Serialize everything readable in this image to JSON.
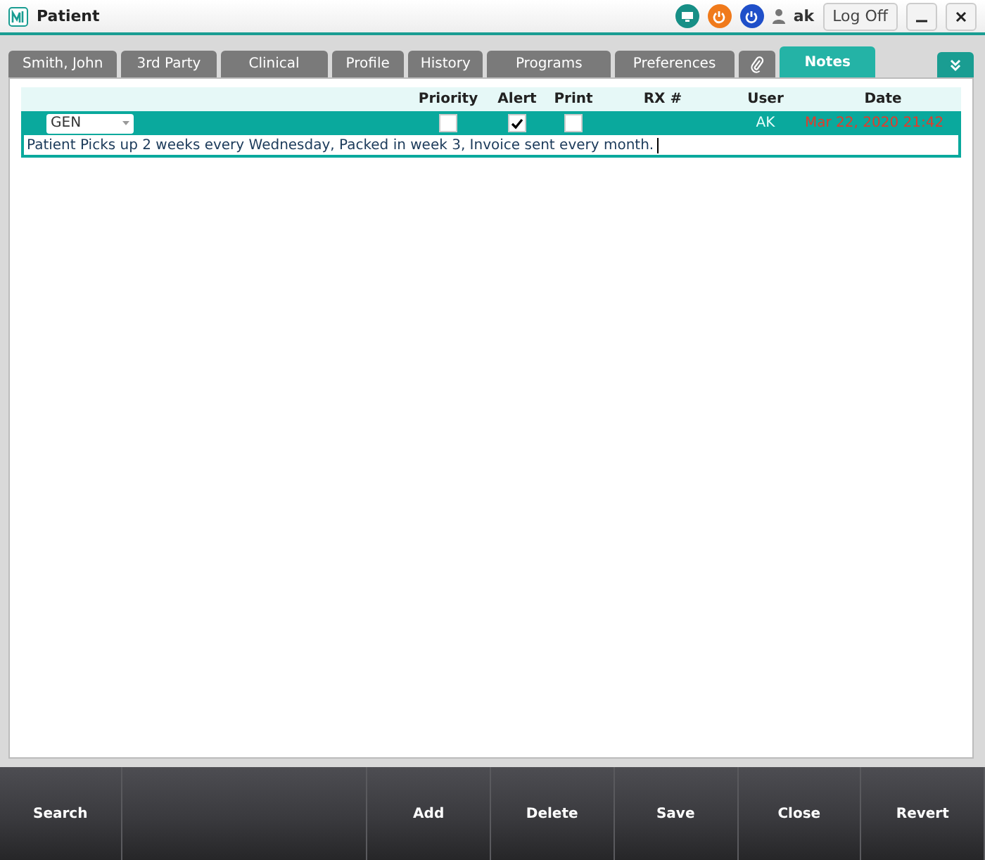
{
  "window": {
    "title": "Patient",
    "user": "ak",
    "log_off": "Log Off"
  },
  "tabs": [
    {
      "label": "Smith, John",
      "selected": false,
      "kind": "text"
    },
    {
      "label": "3rd Party",
      "selected": false,
      "kind": "text"
    },
    {
      "label": "Clinical",
      "selected": false,
      "kind": "text"
    },
    {
      "label": "Profile",
      "selected": false,
      "kind": "text"
    },
    {
      "label": "History",
      "selected": false,
      "kind": "text"
    },
    {
      "label": "Programs",
      "selected": false,
      "kind": "text"
    },
    {
      "label": "Preferences",
      "selected": false,
      "kind": "text"
    },
    {
      "selected": false,
      "kind": "attachment"
    },
    {
      "label": "Notes",
      "selected": true,
      "kind": "text"
    }
  ],
  "notes": {
    "columns": [
      "Priority",
      "Alert",
      "Print",
      "RX #",
      "User",
      "Date"
    ],
    "rows": [
      {
        "type": "GEN",
        "priority": false,
        "alert": true,
        "print": false,
        "user": "AK",
        "date": "Mar 22, 2020 21:42",
        "text": "Patient Picks up 2 weeks every Wednesday, Packed in week 3, Invoice sent every month."
      }
    ]
  },
  "footer": {
    "left_buttons": [
      "Search"
    ],
    "right_buttons": [
      "Add",
      "Delete",
      "Save",
      "Close",
      "Revert"
    ]
  }
}
